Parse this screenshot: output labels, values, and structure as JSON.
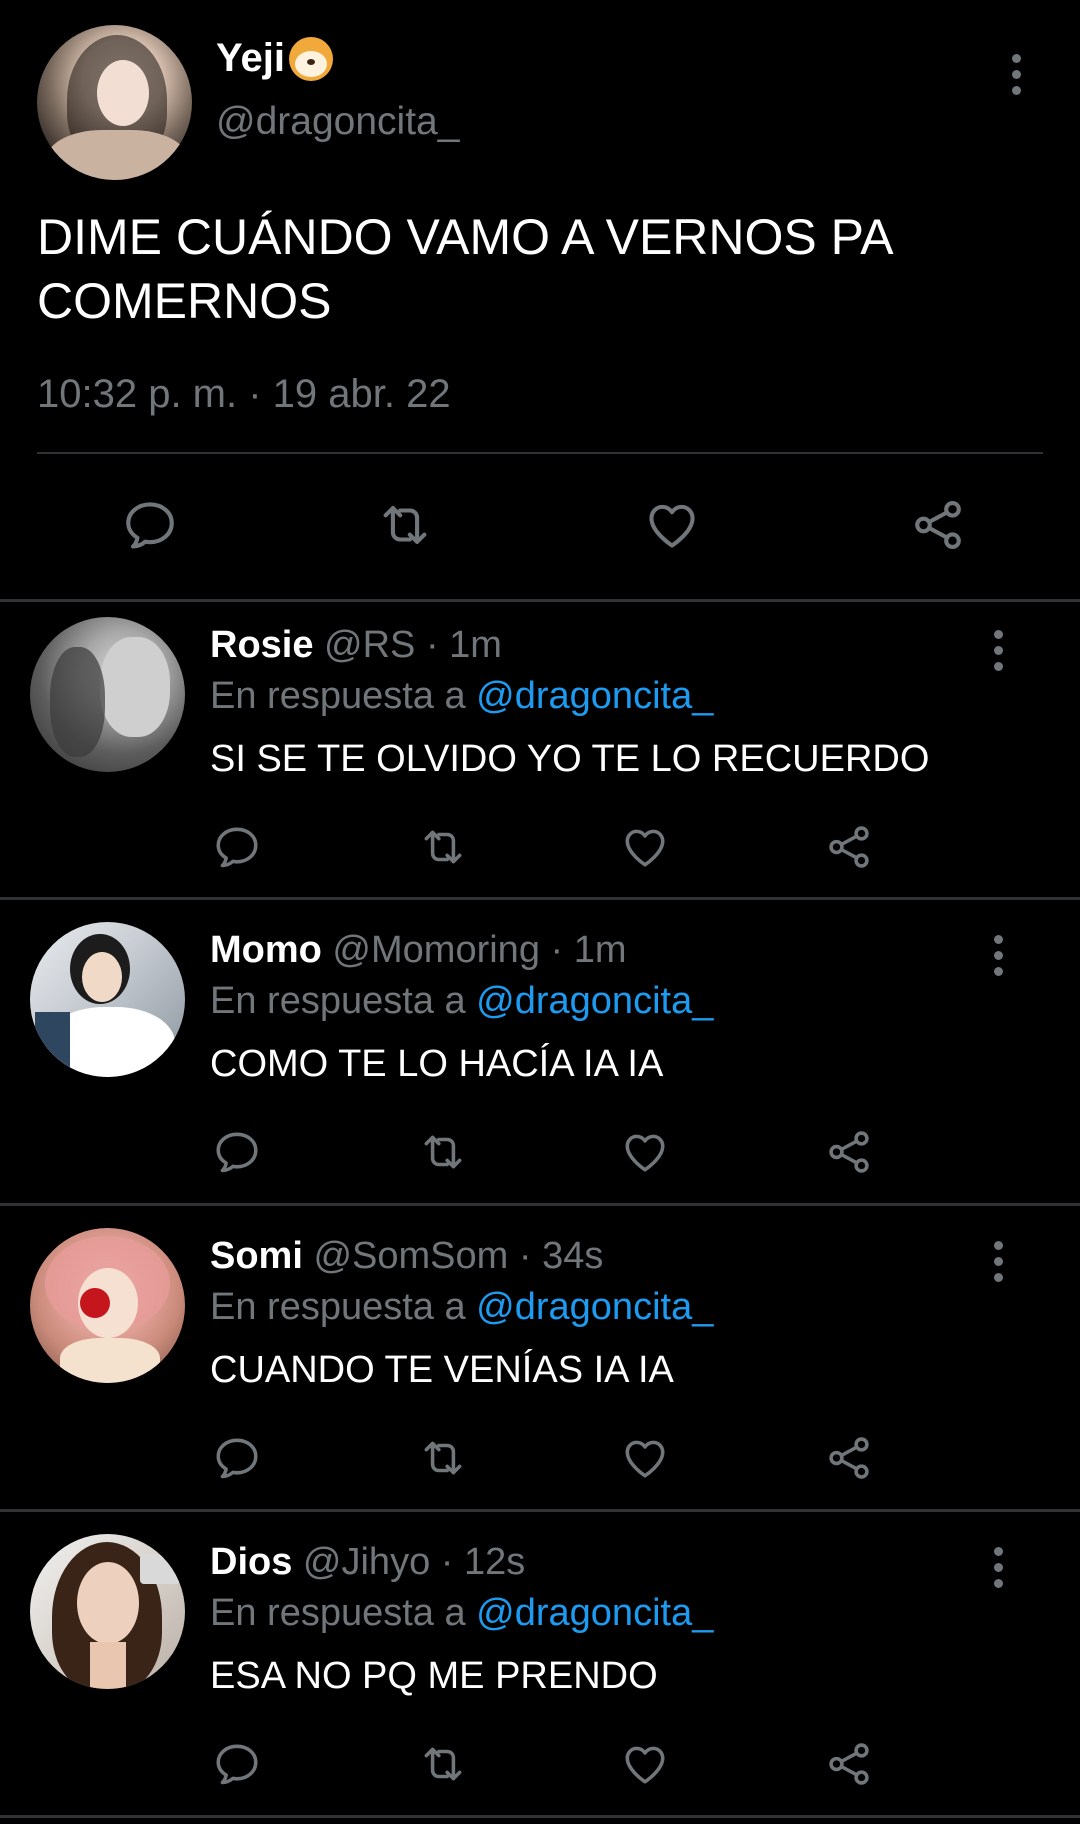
{
  "colors": {
    "background": "#000000",
    "primary_text": "#ffffff",
    "secondary_text": "#71767b",
    "link": "#1d9bf0",
    "divider": "#2f3336"
  },
  "main_tweet": {
    "display_name": "Yeji",
    "name_emoji_icon": "dog-face-emoji-icon",
    "handle": "@dragoncita_",
    "text": "DIME CUÁNDO VAMO A VERNOS PA COMERNOS",
    "timestamp": "10:32 p. m. · 19 abr. 22",
    "actions": [
      "reply-icon",
      "retweet-icon",
      "like-icon",
      "share-icon"
    ]
  },
  "replies": [
    {
      "display_name": "Rosie",
      "handle_meta": " @RS · 1m",
      "reply_prefix": "En respuesta a ",
      "mention": "@dragoncita_",
      "text": "SI SE TE OLVIDO YO TE LO RECUERDO"
    },
    {
      "display_name": "Momo",
      "handle_meta": " @Momoring · 1m",
      "reply_prefix": "En respuesta a ",
      "mention": "@dragoncita_",
      "text": "COMO TE LO HACÍA IA IA"
    },
    {
      "display_name": "Somi",
      "handle_meta": " @SomSom · 34s",
      "reply_prefix": "En respuesta a ",
      "mention": "@dragoncita_",
      "text": "CUANDO TE VENÍAS IA IA"
    },
    {
      "display_name": "Dios",
      "handle_meta": " @Jihyo · 12s",
      "reply_prefix": "En respuesta a ",
      "mention": "@dragoncita_",
      "text": "ESA NO PQ ME PRENDO"
    }
  ]
}
